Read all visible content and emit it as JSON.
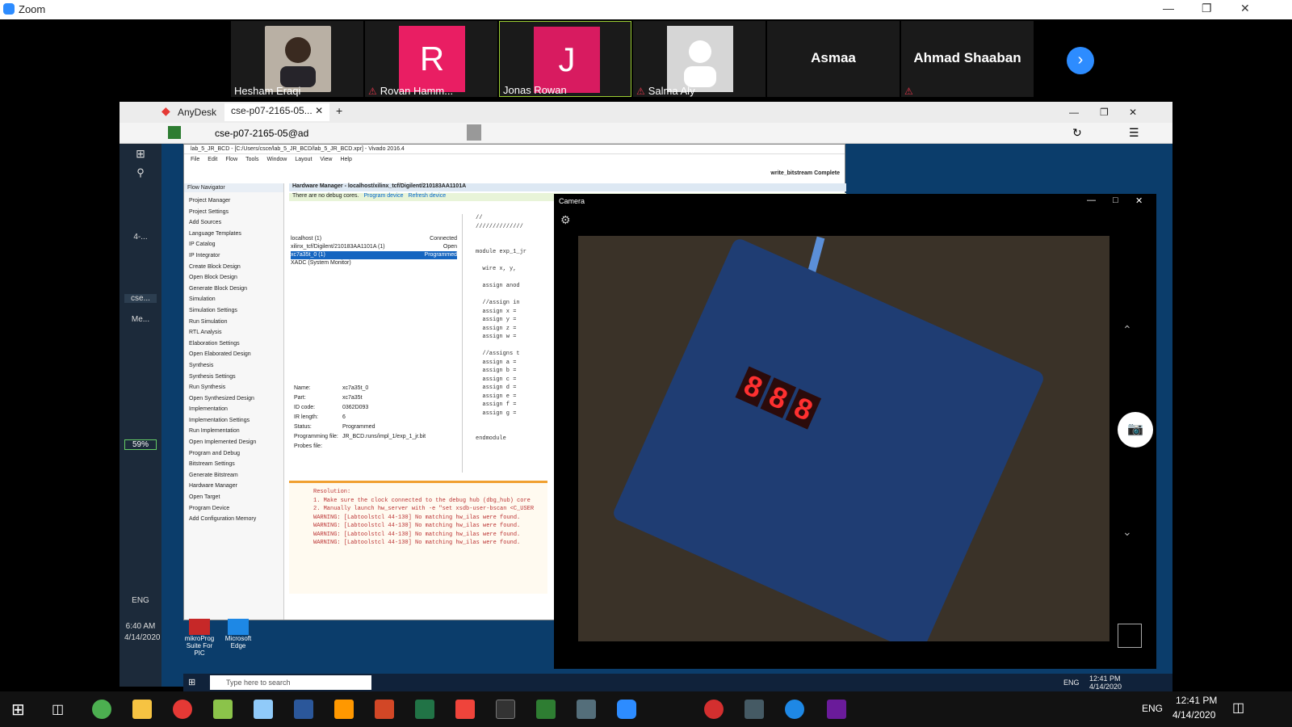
{
  "zoom": {
    "title": "Zoom",
    "participants": [
      {
        "name": "Hesham Eraqi",
        "initial": "",
        "color": "#b9b0a4",
        "muted": false
      },
      {
        "name": "Rovan Hamm...",
        "initial": "R",
        "color": "#e91e63",
        "muted": true
      },
      {
        "name": "Jonas Rowan",
        "initial": "J",
        "color": "#d81b60",
        "muted": false
      },
      {
        "name": "Salma Aly",
        "initial": "",
        "color": "#d6d6d6",
        "muted": true
      },
      {
        "name": "Asmaa",
        "initial": "",
        "color": "",
        "muted": false
      },
      {
        "name": "Ahmad Shaaban",
        "initial": "",
        "color": "",
        "muted": true
      }
    ]
  },
  "anydesk": {
    "app": "AnyDesk",
    "tab": "cse-p07-2165-05...",
    "address": "cse-p07-2165-05@ad"
  },
  "sidebar": {
    "battery": "59%",
    "lang": "ENG",
    "time": "6:40 AM",
    "date": "4/14/2020",
    "items": [
      "4-...",
      "cse...",
      "Me..."
    ]
  },
  "vivado": {
    "title": "lab_5_JR_BCD - [C:/Users/csce/lab_5_JR_BCD/lab_5_JR_BCD.xpr] - Vivado 2016.4",
    "status": "write_bitstream Complete",
    "menu": [
      "File",
      "Edit",
      "Flow",
      "Tools",
      "Window",
      "Layout",
      "View",
      "Help"
    ],
    "nav_title": "Flow Navigator",
    "hw_title": "Hardware Manager - localhost/xilinx_tcf/Digilent/210183AA1101A",
    "notice": "There are no debug cores.",
    "program": "Program device",
    "refresh": "Refresh device",
    "nav": [
      "Project Manager",
      "Project Settings",
      "Add Sources",
      "Language Templates",
      "IP Catalog",
      "IP Integrator",
      "Create Block Design",
      "Open Block Design",
      "Generate Block Design",
      "Simulation",
      "Simulation Settings",
      "Run Simulation",
      "RTL Analysis",
      "Elaboration Settings",
      "Open Elaborated Design",
      "Synthesis",
      "Synthesis Settings",
      "Run Synthesis",
      "Open Synthesized Design",
      "Implementation",
      "Implementation Settings",
      "Run Implementation",
      "Open Implemented Design",
      "Program and Debug",
      "Bitstream Settings",
      "Generate Bitstream",
      "Hardware Manager",
      "Open Target",
      "Program Device",
      "Add Configuration Memory"
    ],
    "hw_rows": [
      {
        "name": "localhost (1)",
        "status": "Connected"
      },
      {
        "name": "xilinx_tcf/Digilent/210183AA1101A (1)",
        "status": "Open"
      },
      {
        "name": "xc7a35t_0 (1)",
        "status": "Programmed"
      },
      {
        "name": "XADC (System Monitor)",
        "status": ""
      }
    ],
    "props": [
      {
        "k": "Name:",
        "v": "xc7a35t_0"
      },
      {
        "k": "Part:",
        "v": "xc7a35t"
      },
      {
        "k": "ID code:",
        "v": "0362D093"
      },
      {
        "k": "IR length:",
        "v": "6"
      },
      {
        "k": "Status:",
        "v": "Programmed"
      },
      {
        "k": "Programming file:",
        "v": "JR_BCD.runs/impl_1/exp_1_jr.bit"
      },
      {
        "k": "Probes file:",
        "v": ""
      }
    ],
    "tcl": [
      "Resolution:",
      "1. Make sure the clock connected to the debug hub (dbg_hub) core",
      "2. Manually launch hw_server with -e \"set xsdb-user-bscan <C_USER",
      "WARNING: [Labtoolstcl 44-130] No matching hw_ilas were found.",
      "WARNING: [Labtoolstcl 44-130] No matching hw_ilas were found.",
      "WARNING: [Labtoolstcl 44-130] No matching hw_ilas were found.",
      "WARNING: [Labtoolstcl 44-130] No matching hw_ilas were found."
    ],
    "code": [
      "//",
      "//////////////",
      "",
      "",
      "module exp_1_jr",
      "",
      "  wire x, y,",
      "",
      "  assign anod",
      "",
      "  //assign in",
      "  assign x =",
      "  assign y =",
      "  assign z =",
      "  assign w =",
      "",
      "  //assigns t",
      "  assign a =",
      "  assign b =",
      "  assign c =",
      "  assign d =",
      "  assign e =",
      "  assign f =",
      "  assign g =",
      "",
      "",
      "endmodule"
    ]
  },
  "camera": {
    "title": "Camera",
    "segments": [
      "8",
      "8",
      "8"
    ]
  },
  "inner": {
    "search": "Type here to search",
    "time": "12:41 PM",
    "date": "4/14/2020",
    "lang": "ENG",
    "desk1": "mikroProg Suite For PIC",
    "desk2": "Microsoft Edge"
  },
  "taskbar": {
    "time": "12:41 PM",
    "date": "4/14/2020",
    "lang": "ENG"
  }
}
